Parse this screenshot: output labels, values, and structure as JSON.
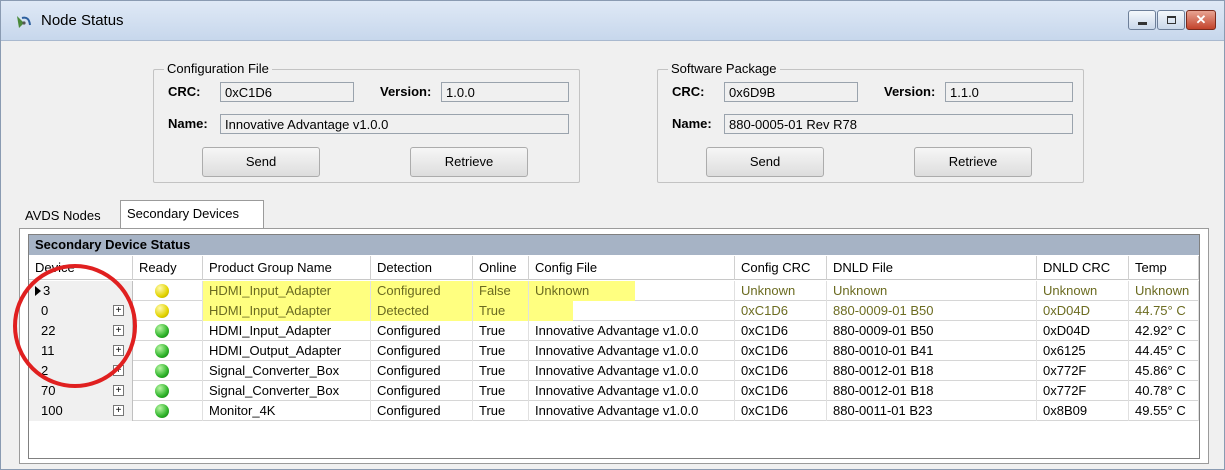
{
  "window": {
    "title": "Node Status",
    "icon": "satellite-dish-icon",
    "controls": {
      "minimize": "minimize-icon",
      "maximize": "maximize-icon",
      "close": "✕"
    }
  },
  "config_file": {
    "legend": "Configuration File",
    "crc_label": "CRC:",
    "crc_value": "0xC1D6",
    "version_label": "Version:",
    "version_value": "1.0.0",
    "name_label": "Name:",
    "name_value": "Innovative Advantage v1.0.0",
    "send_label": "Send",
    "retrieve_label": "Retrieve"
  },
  "software_package": {
    "legend": "Software Package",
    "crc_label": "CRC:",
    "crc_value": "0x6D9B",
    "version_label": "Version:",
    "version_value": "1.1.0",
    "name_label": "Name:",
    "name_value": "880-0005-01 Rev R78",
    "send_label": "Send",
    "retrieve_label": "Retrieve"
  },
  "tabs": [
    {
      "label": "AVDS Nodes",
      "active": false
    },
    {
      "label": "Secondary Devices",
      "active": true
    }
  ],
  "grid": {
    "caption": "Secondary Device Status",
    "columns": [
      "Device",
      "Ready",
      "Product Group Name",
      "Detection",
      "Online",
      "Config File",
      "Config CRC",
      "DNLD File",
      "DNLD CRC",
      "Temp"
    ],
    "rows": [
      {
        "device": "3",
        "ready": "yellow",
        "product": "HDMI_Input_Adapter",
        "detection": "Configured",
        "online": "False",
        "config_file": "Unknown",
        "config_crc": "Unknown",
        "dnld_file": "Unknown",
        "dnld_crc": "Unknown",
        "temp": "Unknown",
        "highlighted": true,
        "current": true,
        "expandable": false
      },
      {
        "device": "0",
        "ready": "yellow",
        "product": "HDMI_Input_Adapter",
        "detection": "Detected",
        "online": "True",
        "config_file": "",
        "config_crc": "0xC1D6",
        "dnld_file": "880-0009-01 B50",
        "dnld_crc": "0xD04D",
        "temp": "44.75° C",
        "highlighted": true,
        "current": false,
        "expandable": true
      },
      {
        "device": "22",
        "ready": "green",
        "product": "HDMI_Input_Adapter",
        "detection": "Configured",
        "online": "True",
        "config_file": "Innovative Advantage v1.0.0",
        "config_crc": "0xC1D6",
        "dnld_file": "880-0009-01 B50",
        "dnld_crc": "0xD04D",
        "temp": "42.92° C",
        "highlighted": false,
        "current": false,
        "expandable": true
      },
      {
        "device": "11",
        "ready": "green",
        "product": "HDMI_Output_Adapter",
        "detection": "Configured",
        "online": "True",
        "config_file": "Innovative Advantage v1.0.0",
        "config_crc": "0xC1D6",
        "dnld_file": "880-0010-01 B41",
        "dnld_crc": "0x6125",
        "temp": "44.45° C",
        "highlighted": false,
        "current": false,
        "expandable": true
      },
      {
        "device": "2",
        "ready": "green",
        "product": "Signal_Converter_Box",
        "detection": "Configured",
        "online": "True",
        "config_file": "Innovative Advantage v1.0.0",
        "config_crc": "0xC1D6",
        "dnld_file": "880-0012-01 B18",
        "dnld_crc": "0x772F",
        "temp": "45.86° C",
        "highlighted": false,
        "current": false,
        "expandable": true
      },
      {
        "device": "70",
        "ready": "green",
        "product": "Signal_Converter_Box",
        "detection": "Configured",
        "online": "True",
        "config_file": "Innovative Advantage v1.0.0",
        "config_crc": "0xC1D6",
        "dnld_file": "880-0012-01 B18",
        "dnld_crc": "0x772F",
        "temp": "40.78° C",
        "highlighted": false,
        "current": false,
        "expandable": true
      },
      {
        "device": "100",
        "ready": "green",
        "product": "Monitor_4K",
        "detection": "Configured",
        "online": "True",
        "config_file": "Innovative Advantage v1.0.0",
        "config_crc": "0xC1D6",
        "dnld_file": "880-0011-01 B23",
        "dnld_crc": "0x8B09",
        "temp": "49.55° C",
        "highlighted": false,
        "current": false,
        "expandable": true
      }
    ]
  },
  "colors": {
    "highlight": "#ffff80",
    "annotation": "#e02020",
    "caption_bg": "#a6b3c5"
  }
}
